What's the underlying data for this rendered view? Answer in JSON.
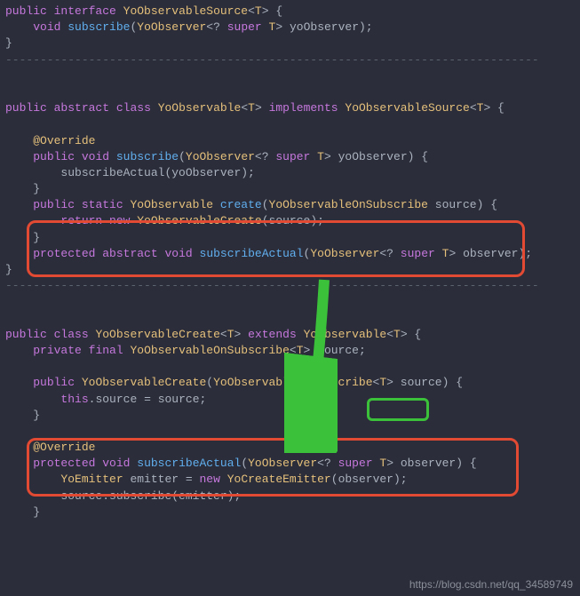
{
  "code": {
    "block1": {
      "l1": "public interface YoObservableSource<T> {",
      "l2": "    void subscribe(YoObserver<? super T> yoObserver);",
      "l3": "}"
    },
    "sep1": "-----------------------------------------------------------------------------",
    "block2": {
      "l1": "public abstract class YoObservable<T> implements YoObservableSource<T> {",
      "l2": "",
      "l3": "    @Override",
      "l4": "    public void subscribe(YoObserver<? super T> yoObserver) {",
      "l5": "        subscribeActual(yoObserver);",
      "l6": "    }",
      "l7": "    public static YoObservable create(YoObservableOnSubscribe source) {",
      "l8": "        return new YoObservableCreate(source);",
      "l9": "    }",
      "l10": "    protected abstract void subscribeActual(YoObserver<? super T> observer);",
      "l11": "}"
    },
    "sep2": "-----------------------------------------------------------------------------",
    "block3": {
      "l1": "public class YoObservableCreate<T> extends YoObservable<T> {",
      "l2": "    private final YoObservableOnSubscribe<T> source;",
      "l3": "",
      "l4": "    public YoObservableCreate(YoObservableOnSubscribe<T> source) {",
      "l5": "        this.source = source;",
      "l6": "    }",
      "l7": "",
      "l8": "    @Override",
      "l9": "    protected void subscribeActual(YoObserver<? super T> observer) {",
      "l10": "        YoEmitter emitter = new YoCreateEmitter(observer);",
      "l11": "        source.subscribe(emitter);",
      "l12": "    }"
    }
  },
  "watermark": "https://blog.csdn.net/qq_34589749",
  "highlights": {
    "red_box_1": "create method in YoObservable",
    "red_box_2": "constructor of YoObservableCreate",
    "green_box": "source field",
    "arrow": "points from create method down to constructor"
  }
}
